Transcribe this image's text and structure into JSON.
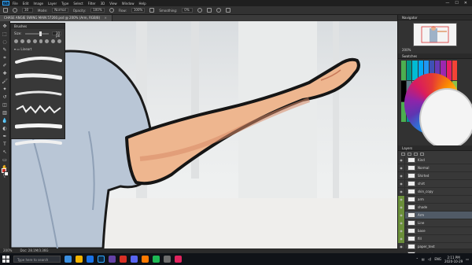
{
  "app": {
    "logo_text": "Ps",
    "menu": [
      "File",
      "Edit",
      "Image",
      "Layer",
      "Type",
      "Select",
      "Filter",
      "3D",
      "View",
      "Window",
      "Help"
    ],
    "window_controls": [
      "—",
      "☐",
      "✕"
    ]
  },
  "options": {
    "brush_size": "30",
    "mode_label": "Mode:",
    "mode_value": "Normal",
    "opacity_label": "Opacity:",
    "opacity_value": "100%",
    "flow_label": "Flow:",
    "flow_value": "100%",
    "smoothing_label": "Smoothing:",
    "smoothing_value": "0%"
  },
  "document": {
    "tab_title": "CHASE ANGIE SWING MAIN 57260.psd @ 200% (Arm, RGB/8)",
    "close": "×"
  },
  "toolbar": {
    "tools": [
      "move-icon",
      "marquee-icon",
      "lasso-icon",
      "quick-select-icon",
      "crop-icon",
      "eyedropper-icon",
      "healing-icon",
      "brush-icon",
      "stamp-icon",
      "history-brush-icon",
      "eraser-icon",
      "gradient-icon",
      "blur-icon",
      "dodge-icon",
      "pen-icon",
      "type-icon",
      "path-select-icon",
      "rectangle-icon",
      "hand-icon",
      "zoom-icon"
    ],
    "glyphs": [
      "✥",
      "⬚",
      "◌",
      "✎",
      "⌗",
      "✐",
      "✚",
      "🖌",
      "✦",
      "↺",
      "◫",
      "▥",
      "💧",
      "◐",
      "✒",
      "T",
      "↖",
      "▭",
      "✋",
      "⚲"
    ],
    "fg_color": "#c8342c",
    "bg_color": "#ffffff"
  },
  "brushes": {
    "title": "Brushes",
    "size_label": "Size:",
    "size_value": "30 px",
    "folder": "Lineart"
  },
  "navigator": {
    "title": "Navigator",
    "zoom": "200%"
  },
  "swatches": {
    "title": "Swatches"
  },
  "layers": {
    "title": "Layers",
    "items": [
      {
        "name": "Kind",
        "selected": false,
        "visible": false
      },
      {
        "name": "Normal",
        "selected": false,
        "visible": false
      },
      {
        "name": "Shirted",
        "selected": false,
        "visible": false
      },
      {
        "name": "shirt",
        "selected": false,
        "visible": false
      },
      {
        "name": "skin_copy",
        "selected": false,
        "visible": false
      },
      {
        "name": "arm",
        "selected": false,
        "visible": true
      },
      {
        "name": "shade",
        "selected": false,
        "visible": true
      },
      {
        "name": "Arm",
        "selected": true,
        "visible": true
      },
      {
        "name": "Line",
        "selected": false,
        "visible": true
      },
      {
        "name": "base",
        "selected": false,
        "visible": true
      },
      {
        "name": "fill",
        "selected": false,
        "visible": true
      },
      {
        "name": "paper_text",
        "selected": false,
        "visible": false
      },
      {
        "name": "paper_art",
        "selected": false,
        "visible": false
      }
    ]
  },
  "status": {
    "zoom": "200%",
    "doc": "Doc: 28.1M/3.36G"
  },
  "taskbar": {
    "search_placeholder": "Type here to search",
    "tray_lang": "ENG",
    "time": "2:11 PM",
    "date": "2020-10-29"
  }
}
